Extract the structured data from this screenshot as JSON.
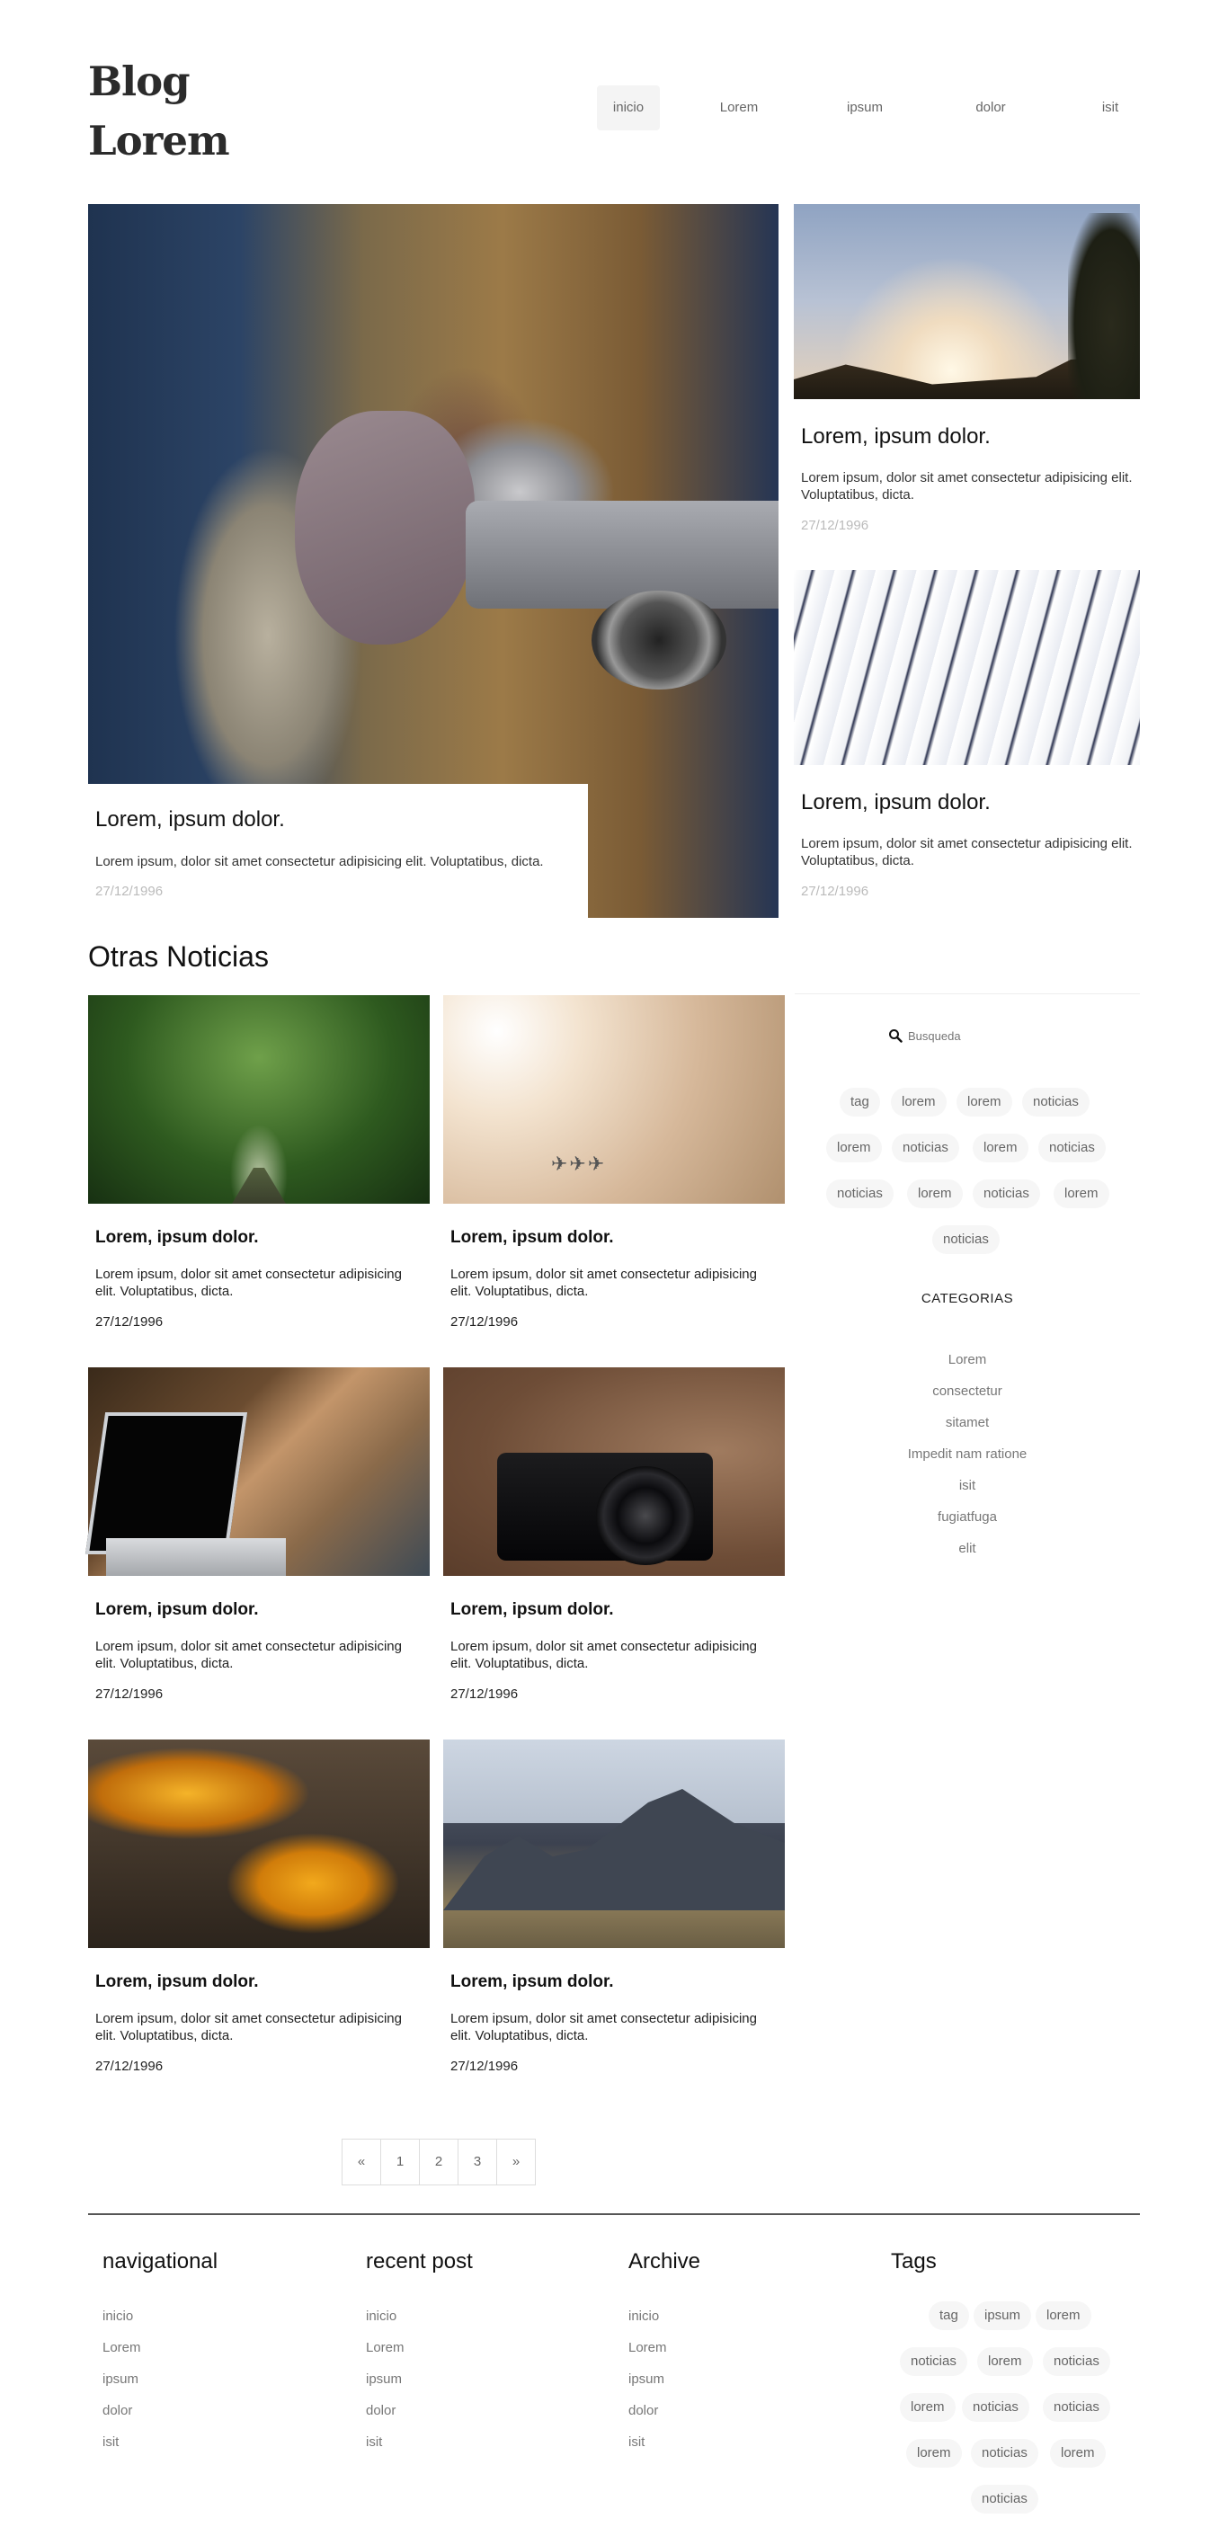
{
  "brand": {
    "line1": "Blog",
    "line2": "Lorem"
  },
  "nav": {
    "items": [
      "inicio",
      "Lorem",
      "ipsum",
      "dolor",
      "isit"
    ],
    "active": "inicio"
  },
  "featured": [
    {
      "title": "Lorem, ipsum dolor.",
      "text": "Lorem ipsum, dolor sit amet consectetur adipisicing elit. Voluptatibus, dicta.",
      "date": "27/12/1996"
    },
    {
      "title": "Lorem, ipsum dolor.",
      "text": "Lorem ipsum, dolor sit amet consectetur adipisicing elit. Voluptatibus, dicta.",
      "date": "27/12/1996"
    },
    {
      "title": "Lorem, ipsum dolor.",
      "text": "Lorem ipsum, dolor sit amet consectetur adipisicing elit. Voluptatibus, dicta.",
      "date": "27/12/1996"
    }
  ],
  "others": {
    "title": "Otras Noticias",
    "cards": [
      {
        "title": "Lorem, ipsum dolor.",
        "text": "Lorem ipsum, dolor sit amet consectetur adipisicing elit. Voluptatibus, dicta.",
        "date": "27/12/1996"
      },
      {
        "title": "Lorem, ipsum dolor.",
        "text": "Lorem ipsum, dolor sit amet consectetur adipisicing elit. Voluptatibus, dicta.",
        "date": "27/12/1996"
      },
      {
        "title": "Lorem, ipsum dolor.",
        "text": "Lorem ipsum, dolor sit amet consectetur adipisicing elit. Voluptatibus, dicta.",
        "date": "27/12/1996"
      },
      {
        "title": "Lorem, ipsum dolor.",
        "text": "Lorem ipsum, dolor sit amet consectetur adipisicing elit. Voluptatibus, dicta.",
        "date": "27/12/1996"
      },
      {
        "title": "Lorem, ipsum dolor.",
        "text": "Lorem ipsum, dolor sit amet consectetur adipisicing elit. Voluptatibus, dicta.",
        "date": "27/12/1996"
      },
      {
        "title": "Lorem, ipsum dolor.",
        "text": "Lorem ipsum, dolor sit amet consectetur adipisicing elit. Voluptatibus, dicta.",
        "date": "27/12/1996"
      }
    ]
  },
  "sidebar": {
    "search_placeholder": "Busqueda",
    "tags": [
      "tag",
      "lorem",
      "lorem",
      "noticias",
      "lorem",
      "noticias",
      "lorem",
      "noticias",
      "noticias",
      "lorem",
      "noticias",
      "lorem",
      "noticias"
    ],
    "categories_title": "CATEGORIAS",
    "categories": [
      "Lorem",
      "consectetur",
      "sitamet",
      "Impedit nam ratione",
      "isit",
      "fugiatfuga",
      "elit"
    ]
  },
  "pagination": [
    "«",
    "1",
    "2",
    "3",
    "»"
  ],
  "footer": {
    "columns": [
      {
        "title": "navigational",
        "links": [
          "inicio",
          "Lorem",
          "ipsum",
          "dolor",
          "isit"
        ]
      },
      {
        "title": "recent post",
        "links": [
          "inicio",
          "Lorem",
          "ipsum",
          "dolor",
          "isit"
        ]
      },
      {
        "title": "Archive",
        "links": [
          "inicio",
          "Lorem",
          "ipsum",
          "dolor",
          "isit"
        ]
      }
    ],
    "tags_title": "Tags",
    "tags": [
      "tag",
      "ipsum",
      "lorem",
      "noticias",
      "lorem",
      "noticias",
      "lorem",
      "noticias",
      "noticias",
      "lorem",
      "noticias",
      "lorem",
      "noticias"
    ]
  },
  "icons": {
    "search": "search-icon"
  }
}
